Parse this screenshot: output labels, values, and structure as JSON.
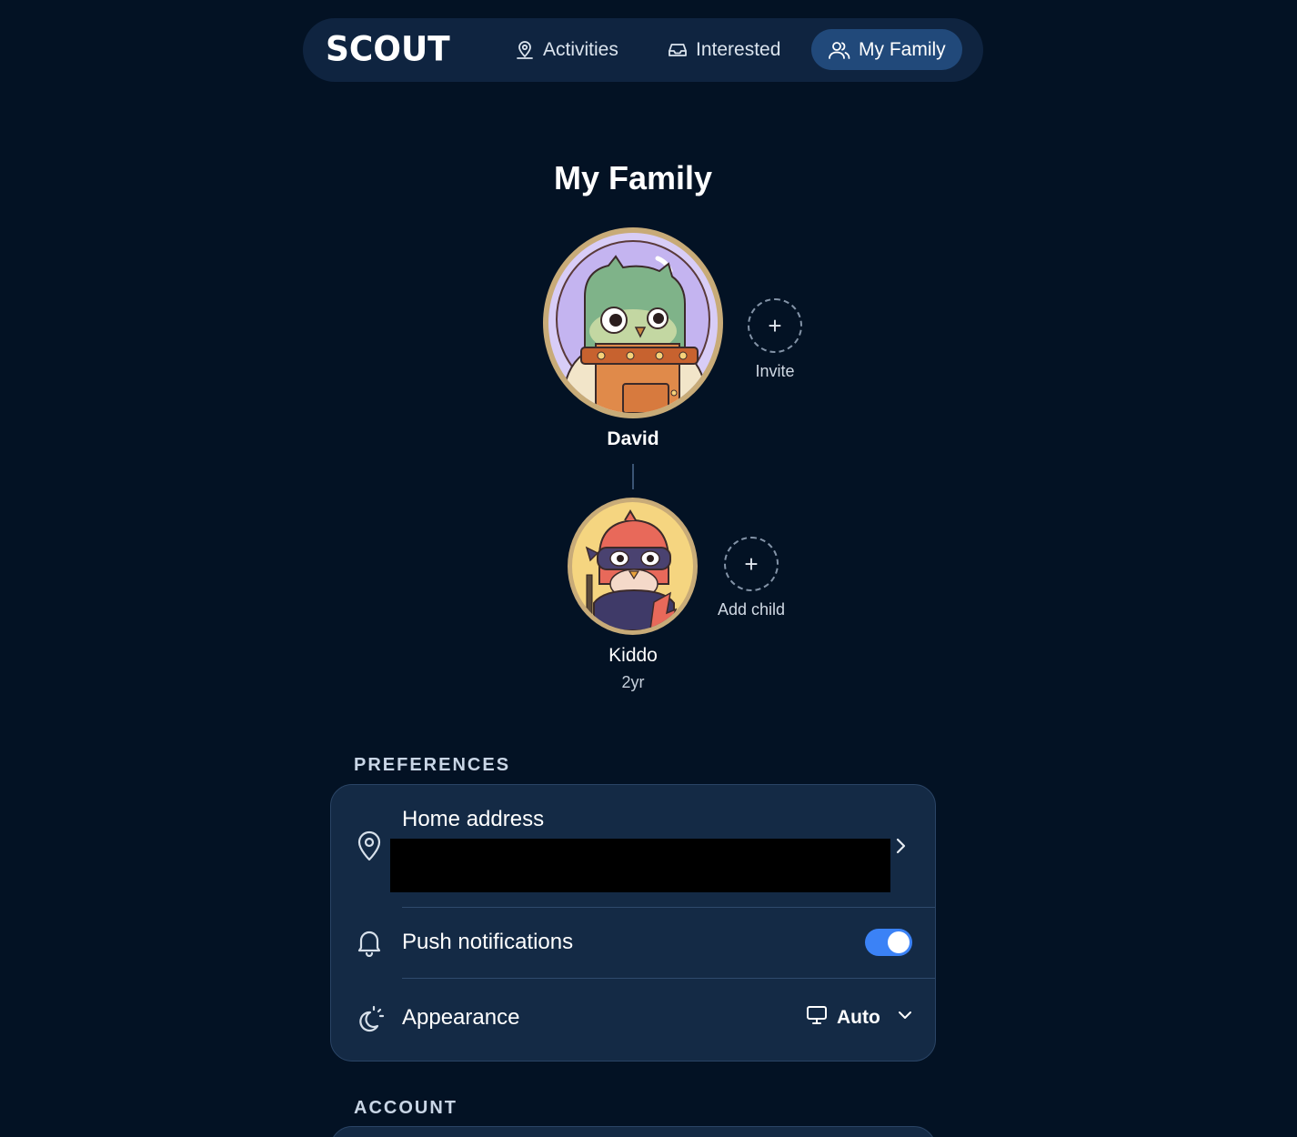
{
  "nav": {
    "logo": "SCOUT",
    "activities_label": "Activities",
    "interested_label": "Interested",
    "family_label": "My Family"
  },
  "page": {
    "title": "My Family"
  },
  "family": {
    "parent": {
      "name": "David"
    },
    "invite_label": "Invite",
    "child": {
      "name": "Kiddo",
      "age": "2yr"
    },
    "add_child_label": "Add child"
  },
  "preferences": {
    "heading": "PREFERENCES",
    "home_address_label": "Home address",
    "push_notifications_label": "Push notifications",
    "push_notifications_enabled": true,
    "appearance_label": "Appearance",
    "appearance_value": "Auto"
  },
  "account": {
    "heading": "ACCOUNT"
  },
  "colors": {
    "background": "#031224",
    "nav_background": "#0f2440",
    "active_tab": "#21497a",
    "card": "#142a45",
    "toggle_on": "#3b82f6",
    "avatar_border": "#c8ab78"
  },
  "icons": {
    "activities": "map-pin-person-icon",
    "interested": "inbox-icon",
    "family": "users-icon",
    "home_address": "location-pin-icon",
    "push_notifications": "bell-icon",
    "appearance": "sun-moon-icon",
    "appearance_select": "monitor-icon"
  }
}
